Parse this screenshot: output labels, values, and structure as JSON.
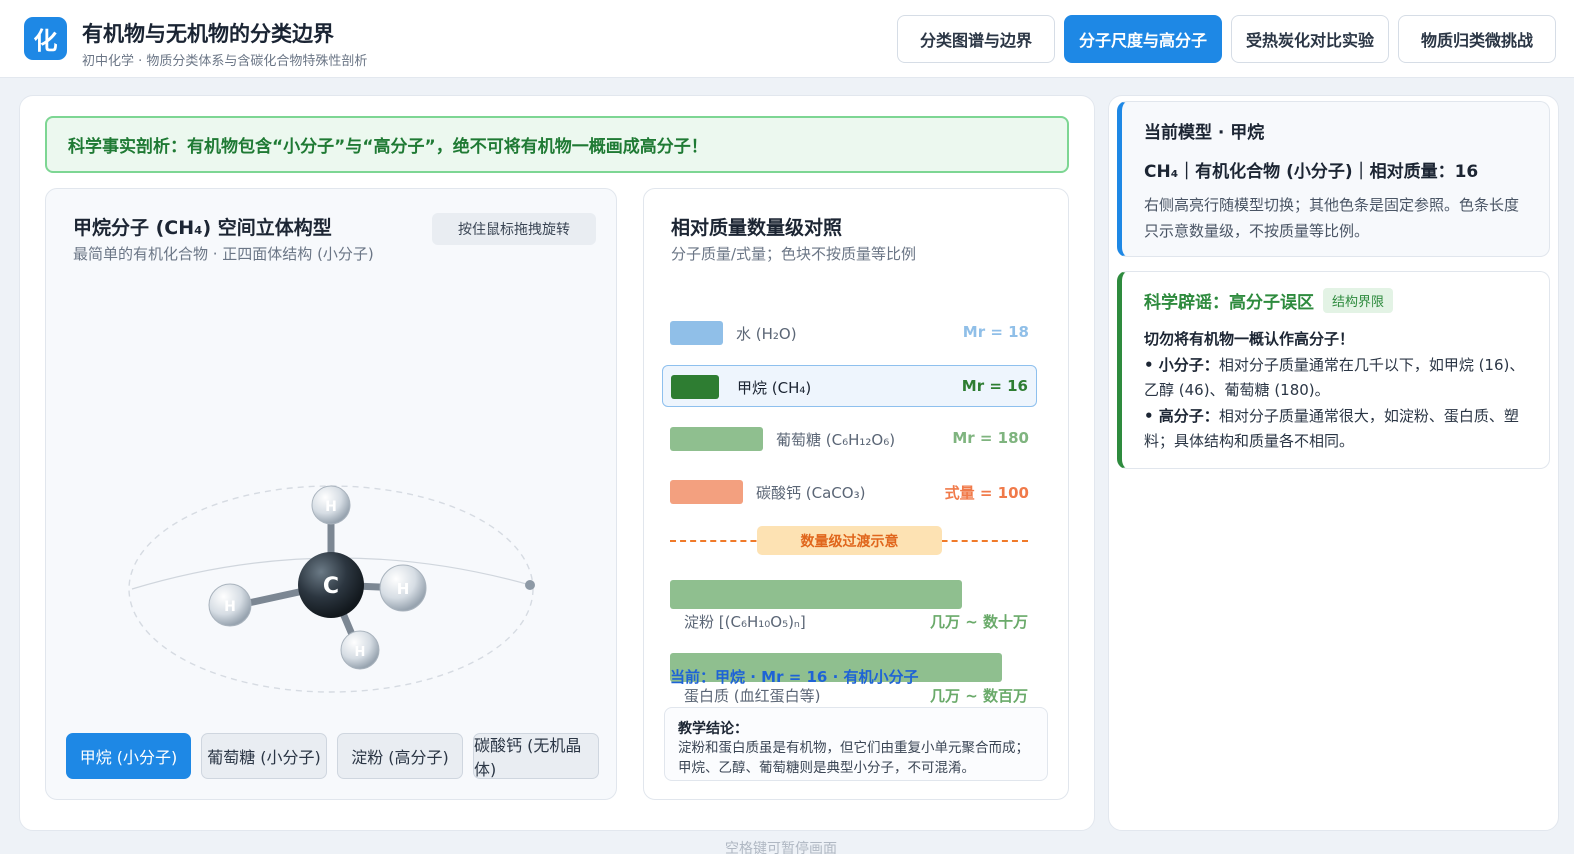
{
  "header": {
    "logo": "化",
    "title": "有机物与无机物的分类边界",
    "subtitle": "初中化学 · 物质分类体系与含碳化合物特殊性剖析",
    "tabs": [
      {
        "label": "分类图谱与边界"
      },
      {
        "label": "分子尺度与高分子"
      },
      {
        "label": "受热炭化对比实验"
      },
      {
        "label": "物质归类微挑战"
      }
    ],
    "active_tab": "分子尺度与高分子"
  },
  "fact_banner": "科学事实剖析：有机物包含“小分子”与“高分子”，绝不可将有机物一概画成高分子！",
  "model_panel": {
    "title": "甲烷分子 (CH₄) 空间立体构型",
    "subtitle": "最简单的有机化合物 · 正四面体结构 (小分子)",
    "rotate_hint": "按住鼠标拖拽旋转",
    "atoms": {
      "center": "C",
      "hydrogen": "H"
    },
    "buttons": [
      {
        "label": "甲烷 (小分子)"
      },
      {
        "label": "葡萄糖 (小分子)"
      },
      {
        "label": "淀粉 (高分子)"
      },
      {
        "label": "碳酸钙 (无机晶体)"
      }
    ],
    "active_button": "甲烷 (小分子)"
  },
  "scale_panel": {
    "title": "相对质量数量级对照",
    "subtitle": "分子质量/式量；色块不按质量等比例",
    "rows": [
      {
        "name": "水 (H₂O)",
        "mr": "Mr = 18",
        "color": "#90bfe8",
        "mr_color": "#90bfe8"
      },
      {
        "name": "甲烷 (CH₄)",
        "mr": "Mr = 16",
        "color": "#2e7d32",
        "mr_color": "#2e7d32"
      },
      {
        "name": "葡萄糖 (C₆H₁₂O₆)",
        "mr": "Mr = 180",
        "color": "#8fbf8f",
        "mr_color": "#7fb47f"
      },
      {
        "name": "碳酸钙 (CaCO₃)",
        "mr": "式量 = 100",
        "color": "#f3a07f",
        "mr_color": "#f07a4a"
      }
    ],
    "transition_label": "数量级过渡示意",
    "macro": [
      {
        "name": "淀粉 [(C₆H₁₀O₅)ₙ]",
        "range": "几万 ~ 数十万"
      },
      {
        "name": "蛋白质 (血红蛋白等)",
        "range": "几万 ~ 数百万"
      }
    ],
    "current": "当前：甲烷 · Mr = 16 · 有机小分子",
    "conclusion_title": "教学结论：",
    "conclusion_line1": "淀粉和蛋白质虽是有机物，但它们由重复小单元聚合而成；",
    "conclusion_line2": "甲烷、乙醇、葡萄糖则是典型小分子，不可混淆。"
  },
  "sidebar": {
    "current_title": "当前模型 · 甲烷",
    "current_strong": "CH₄｜有机化合物 (小分子)｜相对质量：16",
    "current_text": "右侧高亮行随模型切换；其他色条是固定参照。色条长度只示意数量级，不按质量等比例。",
    "myth_title": "科学辟谣：高分子误区",
    "myth_badge": "结构界限",
    "myth_head": "切勿将有机物一概认作高分子！",
    "small_label": "• 小分子：",
    "small_text": "相对分子质量通常在几千以下，如甲烷 (16)、乙醇 (46)、葡萄糖 (180)。",
    "big_label": "• 高分子：",
    "big_text": "相对分子质量通常很大，如淀粉、蛋白质、塑料；具体结构和质量各不相同。"
  },
  "footer_hint": "空格键可暂停画面"
}
